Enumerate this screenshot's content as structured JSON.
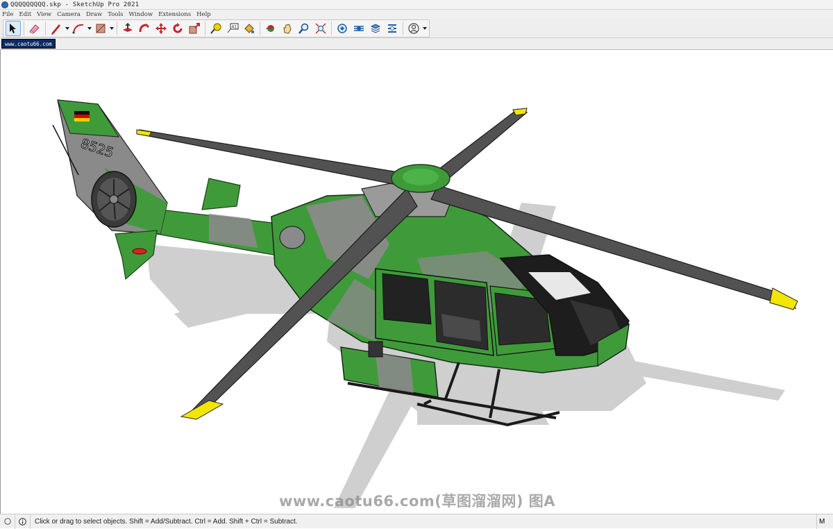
{
  "window": {
    "title": "QQQQQQQQQ.skp - SketchUp Pro 2021"
  },
  "menu": [
    "File",
    "Edit",
    "View",
    "Camera",
    "Draw",
    "Tools",
    "Window",
    "Extensions",
    "Help"
  ],
  "toolbar": {
    "tools": [
      {
        "icon": "select-arrow-icon",
        "active": true
      },
      {
        "icon": "eraser-icon"
      },
      {
        "icon": "pencil-line-icon"
      },
      {
        "icon": "arc-icon"
      },
      {
        "icon": "rectangle-shape-icon"
      },
      {
        "icon": "push-pull-icon"
      },
      {
        "icon": "follow-me-icon"
      },
      {
        "icon": "move-icon"
      },
      {
        "icon": "rotate-icon"
      },
      {
        "icon": "scale-icon"
      },
      {
        "icon": "tape-measure-icon"
      },
      {
        "icon": "text-label-icon"
      },
      {
        "icon": "paint-bucket-icon"
      },
      {
        "icon": "orbit-icon"
      },
      {
        "icon": "pan-hand-icon"
      },
      {
        "icon": "zoom-icon"
      },
      {
        "icon": "zoom-extents-icon"
      },
      {
        "icon": "warehouse-icon"
      },
      {
        "icon": "extension-warehouse-icon"
      },
      {
        "icon": "layout-icon"
      },
      {
        "icon": "extension-manager-icon"
      },
      {
        "icon": "account-icon"
      }
    ]
  },
  "scene_tab": {
    "label": "www.caotu66.com"
  },
  "model": {
    "tail_number": "8525",
    "flag": "Germany",
    "colors": {
      "green": "#3f9b3a",
      "gray": "#8a8a8a",
      "yellow": "#f2e500",
      "shadow": "#cfcfcf"
    }
  },
  "watermark": {
    "text": "www.caotu66.com(草图溜溜网) 图A"
  },
  "status": {
    "message": "Click or drag to select objects. Shift = Add/Subtract. Ctrl = Add. Shift + Ctrl = Subtract.",
    "right_fragment": "M"
  }
}
